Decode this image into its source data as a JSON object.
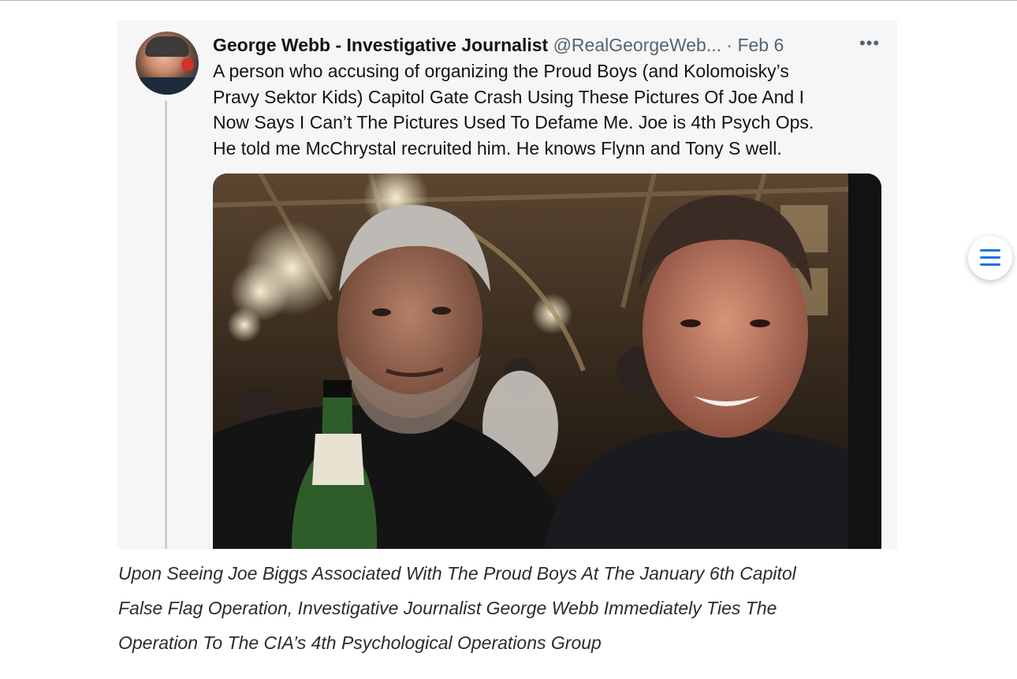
{
  "tweet": {
    "author_name": "George Webb - Investigative Journalist",
    "author_handle": "@RealGeorgeWeb...",
    "separator": "·",
    "date": "Feb 6",
    "more_label": "•••",
    "text_lines": [
      "A person who accusing of organizing the Proud Boys (and Kolomoisky’s",
      "Pravy Sektor Kids) Capitol Gate Crash Using These Pictures Of Joe And I",
      "Now Says I Can’t The Pictures Used To Defame Me. Joe is 4th Psych Ops.",
      "He told me McChrystal recruited him. He knows Flynn and Tony S well."
    ]
  },
  "caption": {
    "lines": [
      "Upon Seeing Joe Biggs Associated With The Proud Boys At The January 6th Capitol",
      "False Flag Operation, Investigative Journalist George Webb Immediately Ties The",
      "Operation To The CIA’s 4th Psychological Operations Group"
    ]
  },
  "icons": {
    "more": "more-horizontal-icon",
    "toc": "menu-icon"
  },
  "colors": {
    "toc_accent": "#1a73e8",
    "card_background": "#f6f6f7",
    "thread_line": "#c9ccd9"
  }
}
